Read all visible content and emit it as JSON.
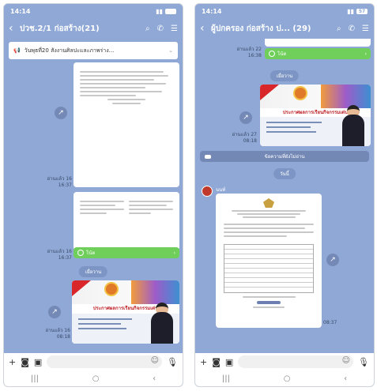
{
  "left": {
    "status": {
      "time": "14:14"
    },
    "header": {
      "title": "ปวช.2/1 ก่อสร้าง(21)"
    },
    "announcement": {
      "text": "วันพุธที่20 สังงานศิลปะและภาพร่าง..."
    },
    "messages": {
      "read_1": "อ่านแล้ว 16",
      "time_1": "16:37",
      "read_2": "อ่านแล้ว 16",
      "time_2": "16:37",
      "keep_label": "โน้ต",
      "date_pill": "เมื่อวาน",
      "read_3": "อ่านแล้ว 16",
      "time_3": "08:18"
    },
    "banner": {
      "title": "ประกาศผลการเรียนกิจกรรมเด่น"
    }
  },
  "right": {
    "status": {
      "time": "14:14",
      "battery": "57"
    },
    "header": {
      "title": "ผู้ปกครอง ก่อสร้าง ป... (29)"
    },
    "messages": {
      "read_1": "อ่านแล้ว 22",
      "time_1": "16:38",
      "keep_label": "โน้ต",
      "date_pill_1": "เมื่อวาน",
      "read_2": "อ่านแล้ว 27",
      "time_2": "08:18",
      "notice": "ข้อความที่ยังไม่อ่าน",
      "date_pill_2": "วันนี้",
      "sender": "นนท์",
      "time_3": "08:37"
    },
    "banner": {
      "title": "ประกาศผลการเรียนกิจกรรมเด่น"
    }
  }
}
